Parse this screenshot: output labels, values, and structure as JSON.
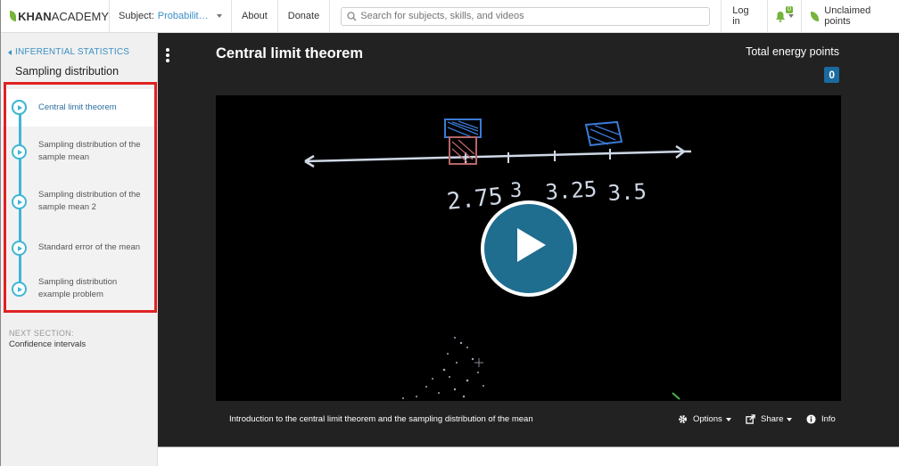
{
  "nav": {
    "logo_left": "KHAN",
    "logo_right": "ACADEMY",
    "subject_label": "Subject:",
    "subject_value": "Probability an...",
    "about": "About",
    "donate": "Donate",
    "search_placeholder": "Search for subjects, skills, and videos",
    "login": "Log in",
    "notification_count": "0",
    "points": "Unclaimed points"
  },
  "sidebar": {
    "back_label": "INFERENTIAL STATISTICS",
    "section_title": "Sampling distribution",
    "lessons": [
      {
        "label": "Central limit theorem",
        "active": true
      },
      {
        "label": "Sampling distribution of the sample mean"
      },
      {
        "label": "Sampling distribution of the sample mean 2"
      },
      {
        "label": "Standard error of the mean"
      },
      {
        "label": "Sampling distribution example problem"
      }
    ],
    "next_heading": "NEXT SECTION:",
    "next_value": "Confidence intervals"
  },
  "main": {
    "title": "Central limit theorem",
    "energy_label": "Total energy points",
    "energy_value": "0",
    "video_whiteboard_numbers": "2.75  3  3.25  3.5",
    "description": "Introduction to the central limit theorem and the sampling distribution of the mean",
    "options": "Options",
    "share": "Share",
    "info": "Info"
  },
  "colors": {
    "accent_blue": "#3a8fc5",
    "timeline": "#40b6d3",
    "play_button": "#1f6d8f",
    "highlight_box": "#e02222",
    "brand_green": "#74b43c"
  }
}
